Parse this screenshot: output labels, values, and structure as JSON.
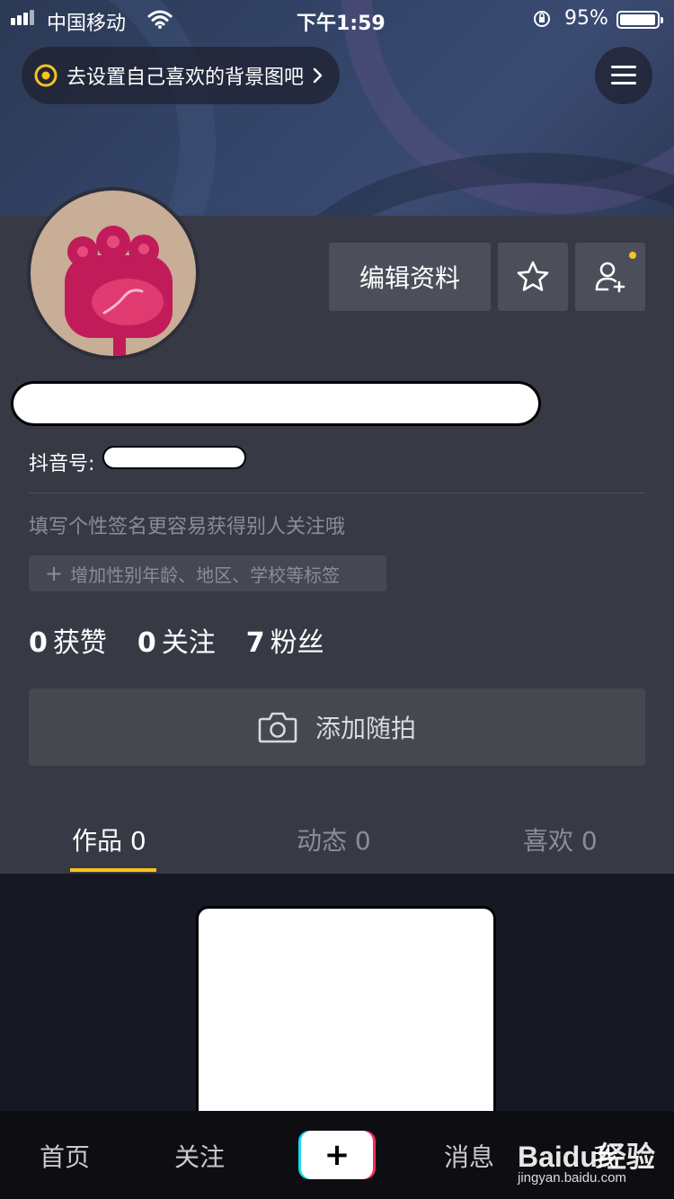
{
  "status_bar": {
    "carrier": "中国移动",
    "time": "下午1:59",
    "battery": "95%",
    "battery_level": 0.95
  },
  "header": {
    "bg_tip": "去设置自己喜欢的背景图吧",
    "menu_icon": "hamburger-menu-icon"
  },
  "profile": {
    "edit_label": "编辑资料",
    "id_label": "抖音号:",
    "signature_hint": "填写个性签名更容易获得别人关注哦",
    "tag_hint": "增加性别年龄、地区、学校等标签",
    "stats": [
      {
        "num": "0",
        "label": "获赞"
      },
      {
        "num": "0",
        "label": "关注"
      },
      {
        "num": "7",
        "label": "粉丝"
      }
    ],
    "random_shot_label": "添加随拍"
  },
  "tabs": [
    {
      "label": "作品 0",
      "active": true
    },
    {
      "label": "动态 0",
      "active": false
    },
    {
      "label": "喜欢 0",
      "active": false
    }
  ],
  "bottom_nav": {
    "home": "首页",
    "follow": "关注",
    "plus": "+",
    "messages": "消息",
    "me": "我"
  },
  "watermark": {
    "brand": "Baidu经验",
    "url": "jingyan.baidu.com"
  },
  "colors": {
    "accent": "#f8c41b",
    "card_bg": "#373a45",
    "page_bg": "#161823",
    "button_bg": "#4c4f5a"
  }
}
